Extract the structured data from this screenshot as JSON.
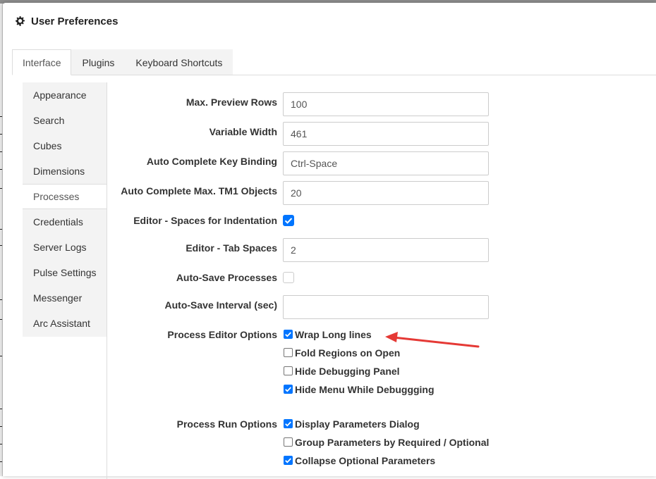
{
  "dialog": {
    "title": "User Preferences"
  },
  "tabs": [
    {
      "label": "Interface",
      "active": true
    },
    {
      "label": "Plugins",
      "active": false
    },
    {
      "label": "Keyboard Shortcuts",
      "active": false
    }
  ],
  "sidebar": {
    "items": [
      {
        "label": "Appearance",
        "active": false
      },
      {
        "label": "Search",
        "active": false
      },
      {
        "label": "Cubes",
        "active": false
      },
      {
        "label": "Dimensions",
        "active": false
      },
      {
        "label": "Processes",
        "active": true
      },
      {
        "label": "Credentials",
        "active": false
      },
      {
        "label": "Server Logs",
        "active": false
      },
      {
        "label": "Pulse Settings",
        "active": false
      },
      {
        "label": "Messenger",
        "active": false
      },
      {
        "label": "Arc Assistant",
        "active": false
      }
    ]
  },
  "form": {
    "max_preview_rows": {
      "label": "Max. Preview Rows",
      "value": "100"
    },
    "variable_width": {
      "label": "Variable Width",
      "value": "461"
    },
    "autocomplete_key_binding": {
      "label": "Auto Complete Key Binding",
      "value": "Ctrl-Space"
    },
    "autocomplete_max_objects": {
      "label": "Auto Complete Max. TM1 Objects",
      "value": "20"
    },
    "spaces_for_indentation": {
      "label": "Editor - Spaces for Indentation",
      "checked": true
    },
    "tab_spaces": {
      "label": "Editor - Tab Spaces",
      "value": "2"
    },
    "auto_save": {
      "label": "Auto-Save Processes",
      "checked": false
    },
    "auto_save_interval": {
      "label": "Auto-Save Interval (sec)",
      "value": ""
    },
    "editor_options": {
      "label": "Process Editor Options",
      "options": [
        {
          "label": "Wrap Long lines",
          "checked": true
        },
        {
          "label": "Fold Regions on Open",
          "checked": false
        },
        {
          "label": "Hide Debugging Panel",
          "checked": false
        },
        {
          "label": "Hide Menu While Debuggging",
          "checked": true
        }
      ]
    },
    "run_options": {
      "label": "Process Run Options",
      "options": [
        {
          "label": "Display Parameters Dialog",
          "checked": true
        },
        {
          "label": "Group Parameters by Required / Optional",
          "checked": false
        },
        {
          "label": "Collapse Optional Parameters",
          "checked": true
        }
      ]
    }
  },
  "colors": {
    "accent": "#0075ff",
    "arrow": "#e53935"
  },
  "icons": {
    "title": "gear-icon",
    "checkbox": "check-icon",
    "annotation": "red-arrow-icon"
  }
}
